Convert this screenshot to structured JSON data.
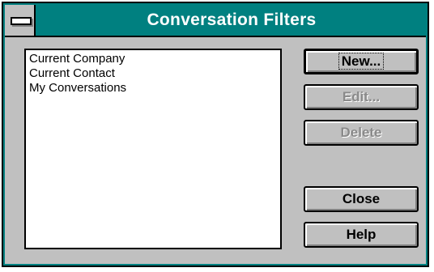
{
  "window": {
    "title": "Conversation Filters"
  },
  "filters": {
    "items": [
      "Current Company",
      "Current Contact",
      "My Conversations"
    ]
  },
  "buttons": {
    "new_label": "New...",
    "edit_label": "Edit...",
    "delete_label": "Delete",
    "close_label": "Close",
    "help_label": "Help"
  },
  "colors": {
    "titlebar": "#008080",
    "face": "#c0c0c0",
    "disabled_text": "#8a8a8a"
  },
  "icons": {
    "system_menu": "system-menu-icon"
  }
}
